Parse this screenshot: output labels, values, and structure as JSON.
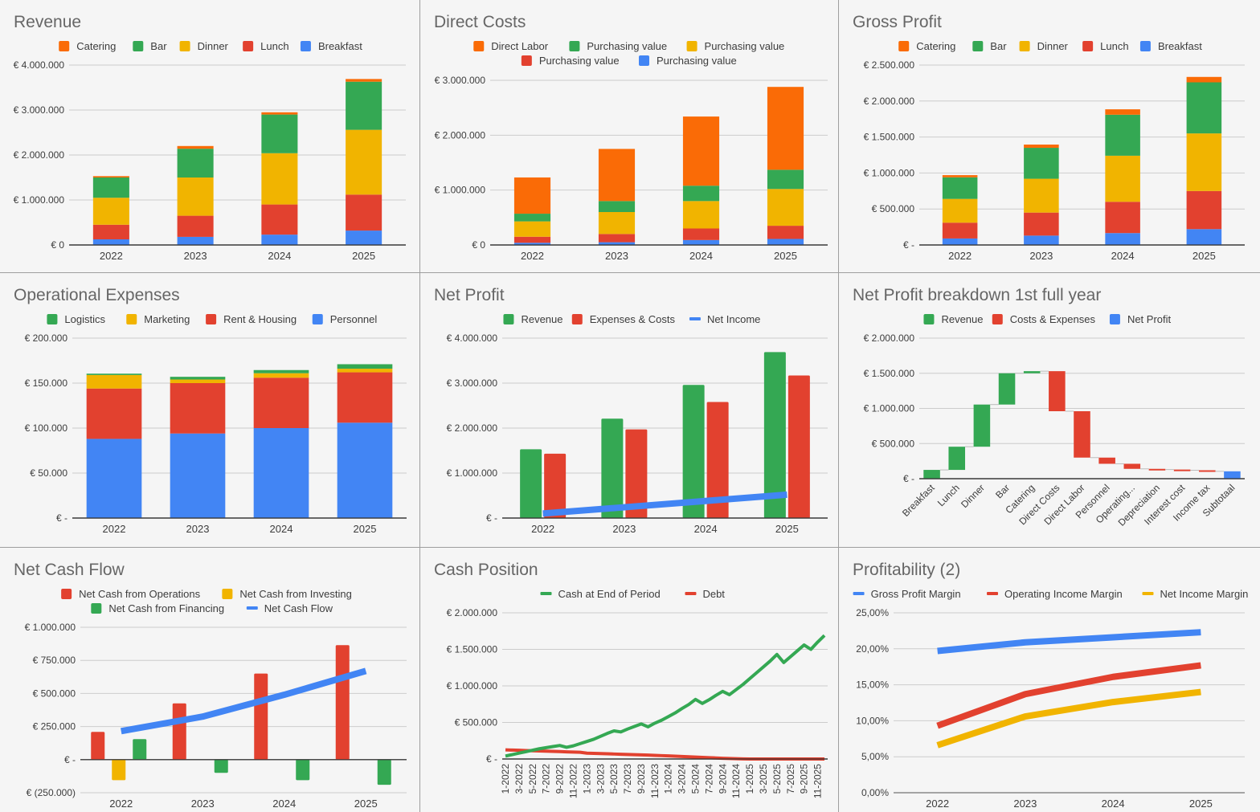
{
  "colors": {
    "blue": "#4285f4",
    "red": "#e2412f",
    "yellow": "#f1b400",
    "green": "#34a853",
    "orange": "#fa6b06",
    "title": "#666666",
    "text": "#3c3c3c",
    "grid": "#cccccc",
    "axis": "#333333"
  },
  "chart_data": [
    {
      "id": "revenue",
      "type": "bar",
      "stacked": true,
      "title": "Revenue",
      "legend": [
        "Catering",
        "Bar",
        "Dinner",
        "Lunch",
        "Breakfast"
      ],
      "legend_colors": [
        "orange",
        "green",
        "yellow",
        "red",
        "blue"
      ],
      "legend_position": "top",
      "categories": [
        "2022",
        "2023",
        "2024",
        "2025"
      ],
      "series": [
        {
          "name": "Breakfast",
          "color": "blue",
          "values": [
            125000,
            180000,
            230000,
            320000
          ]
        },
        {
          "name": "Lunch",
          "color": "red",
          "values": [
            325000,
            470000,
            670000,
            800000
          ]
        },
        {
          "name": "Dinner",
          "color": "yellow",
          "values": [
            600000,
            850000,
            1140000,
            1440000
          ]
        },
        {
          "name": "Bar",
          "color": "green",
          "values": [
            450000,
            640000,
            860000,
            1070000
          ]
        },
        {
          "name": "Catering",
          "color": "orange",
          "values": [
            30000,
            60000,
            50000,
            60000
          ]
        }
      ],
      "ylim": [
        0,
        4000000
      ],
      "yticks": [
        0,
        1000000,
        2000000,
        3000000,
        4000000
      ],
      "ytick_labels": [
        "€ 0",
        "€ 1.000.000",
        "€ 2.000.000",
        "€ 3.000.000",
        "€ 4.000.000"
      ],
      "grid": true
    },
    {
      "id": "direct-costs",
      "type": "bar",
      "stacked": true,
      "title": "Direct Costs",
      "legend": [
        "Direct Labor",
        "Purchasing value",
        "Purchasing value",
        "Purchasing value",
        "Purchasing value"
      ],
      "legend_colors": [
        "orange",
        "green",
        "yellow",
        "red",
        "blue"
      ],
      "legend_rows": [
        3,
        2
      ],
      "legend_position": "top",
      "categories": [
        "2022",
        "2023",
        "2024",
        "2025"
      ],
      "series": [
        {
          "name": "Purchasing value",
          "color": "blue",
          "values": [
            40000,
            50000,
            90000,
            110000
          ]
        },
        {
          "name": "Purchasing value",
          "color": "red",
          "values": [
            110000,
            150000,
            210000,
            240000
          ]
        },
        {
          "name": "Purchasing value",
          "color": "yellow",
          "values": [
            280000,
            400000,
            500000,
            670000
          ]
        },
        {
          "name": "Purchasing value",
          "color": "green",
          "values": [
            140000,
            200000,
            280000,
            350000
          ]
        },
        {
          "name": "Direct Labor",
          "color": "orange",
          "values": [
            660000,
            950000,
            1260000,
            1510000
          ]
        }
      ],
      "ylim": [
        0,
        3000000
      ],
      "yticks": [
        0,
        1000000,
        2000000,
        3000000
      ],
      "ytick_labels": [
        "€ 0",
        "€ 1.000.000",
        "€ 2.000.000",
        "€ 3.000.000"
      ],
      "grid": true
    },
    {
      "id": "gross-profit",
      "type": "bar",
      "stacked": true,
      "title": "Gross Profit",
      "legend": [
        "Catering",
        "Bar",
        "Dinner",
        "Lunch",
        "Breakfast"
      ],
      "legend_colors": [
        "orange",
        "green",
        "yellow",
        "red",
        "blue"
      ],
      "legend_position": "top",
      "categories": [
        "2022",
        "2023",
        "2024",
        "2025"
      ],
      "series": [
        {
          "name": "Breakfast",
          "color": "blue",
          "values": [
            90000,
            130000,
            165000,
            220000
          ]
        },
        {
          "name": "Lunch",
          "color": "red",
          "values": [
            220000,
            320000,
            435000,
            530000
          ]
        },
        {
          "name": "Dinner",
          "color": "yellow",
          "values": [
            330000,
            470000,
            640000,
            800000
          ]
        },
        {
          "name": "Bar",
          "color": "green",
          "values": [
            300000,
            430000,
            570000,
            710000
          ]
        },
        {
          "name": "Catering",
          "color": "orange",
          "values": [
            30000,
            45000,
            75000,
            75000
          ]
        }
      ],
      "ylim": [
        0,
        2500000
      ],
      "yticks": [
        0,
        500000,
        1000000,
        1500000,
        2000000,
        2500000
      ],
      "ytick_labels": [
        "€ -",
        "€ 500.000",
        "€ 1.000.000",
        "€ 1.500.000",
        "€ 2.000.000",
        "€ 2.500.000"
      ],
      "grid": true
    },
    {
      "id": "operational-expenses",
      "type": "bar",
      "stacked": true,
      "title": "Operational Expenses",
      "legend": [
        "Logistics",
        "Marketing",
        "Rent & Housing",
        "Personnel"
      ],
      "legend_colors": [
        "green",
        "yellow",
        "red",
        "blue"
      ],
      "legend_position": "top",
      "categories": [
        "2022",
        "2023",
        "2024",
        "2025"
      ],
      "series": [
        {
          "name": "Personnel",
          "color": "blue",
          "values": [
            88000,
            94000,
            100000,
            106000
          ]
        },
        {
          "name": "Rent & Housing",
          "color": "red",
          "values": [
            56000,
            56000,
            56000,
            56000
          ]
        },
        {
          "name": "Marketing",
          "color": "yellow",
          "values": [
            15000,
            4000,
            5000,
            4000
          ]
        },
        {
          "name": "Logistics",
          "color": "green",
          "values": [
            1500,
            3000,
            3500,
            5000
          ]
        }
      ],
      "ylim": [
        0,
        200000
      ],
      "yticks": [
        0,
        50000,
        100000,
        150000,
        200000
      ],
      "ytick_labels": [
        "€ -",
        "€ 50.000",
        "€ 100.000",
        "€ 150.000",
        "€ 200.000"
      ],
      "grid": true
    },
    {
      "id": "net-profit",
      "type": "bar",
      "stacked": false,
      "title": "Net Profit",
      "legend": [
        "Revenue",
        "Expenses & Costs",
        "Net Income"
      ],
      "legend_colors": [
        "green",
        "red",
        "blue"
      ],
      "legend_kinds": [
        "box",
        "box",
        "line"
      ],
      "legend_position": "top",
      "categories": [
        "2022",
        "2023",
        "2024",
        "2025"
      ],
      "series": [
        {
          "name": "Revenue",
          "color": "green",
          "kind": "bar",
          "values": [
            1530000,
            2210000,
            2960000,
            3690000
          ]
        },
        {
          "name": "Expenses & Costs",
          "color": "red",
          "kind": "bar",
          "values": [
            1430000,
            1970000,
            2580000,
            3170000
          ]
        },
        {
          "name": "Net Income",
          "color": "blue",
          "kind": "line",
          "values": [
            100000,
            240000,
            380000,
            520000
          ]
        }
      ],
      "ylim": [
        0,
        4000000
      ],
      "yticks": [
        0,
        1000000,
        2000000,
        3000000,
        4000000
      ],
      "ytick_labels": [
        "€ -",
        "€ 1.000.000",
        "€ 2.000.000",
        "€ 3.000.000",
        "€ 4.000.000"
      ],
      "grid": true
    },
    {
      "id": "net-profit-breakdown",
      "type": "bar",
      "subtype": "waterfall",
      "title": "Net Profit breakdown 1st full year",
      "legend": [
        "Revenue",
        "Costs & Expenses",
        "Net Profit"
      ],
      "legend_colors": [
        "green",
        "red",
        "blue"
      ],
      "legend_position": "top",
      "categories": [
        "Breakfast",
        "Lunch",
        "Dinner",
        "Bar",
        "Catering",
        "Direct Costs",
        "Direct Labor",
        "Personnel",
        "Operating...",
        "Depreciation",
        "Interest cost",
        "Income tax",
        "Subtotaal"
      ],
      "steps": [
        {
          "label": "Breakfast",
          "type": "increase",
          "value": 125000
        },
        {
          "label": "Lunch",
          "type": "increase",
          "value": 330000
        },
        {
          "label": "Dinner",
          "type": "increase",
          "value": 600000
        },
        {
          "label": "Bar",
          "type": "increase",
          "value": 445000
        },
        {
          "label": "Catering",
          "type": "increase",
          "value": 30000
        },
        {
          "label": "Direct Costs",
          "type": "decrease",
          "value": -570000
        },
        {
          "label": "Direct Labor",
          "type": "decrease",
          "value": -660000
        },
        {
          "label": "Personnel",
          "type": "decrease",
          "value": -88000
        },
        {
          "label": "Operating...",
          "type": "decrease",
          "value": -72000
        },
        {
          "label": "Depreciation",
          "type": "decrease",
          "value": -10000
        },
        {
          "label": "Interest cost",
          "type": "decrease",
          "value": -10000
        },
        {
          "label": "Income tax",
          "type": "decrease",
          "value": -15000
        },
        {
          "label": "Subtotaal",
          "type": "total",
          "value": 105000
        }
      ],
      "ylim": [
        0,
        2000000
      ],
      "yticks": [
        0,
        500000,
        1000000,
        1500000,
        2000000
      ],
      "ytick_labels": [
        "€ -",
        "€ 500.000",
        "€ 1.000.000",
        "€ 1.500.000",
        "€ 2.000.000"
      ],
      "grid": true
    },
    {
      "id": "net-cash-flow",
      "type": "bar",
      "stacked": false,
      "title": "Net Cash Flow",
      "legend": [
        "Net Cash from Operations",
        "Net Cash from Investing",
        "Net Cash from Financing",
        "Net Cash Flow"
      ],
      "legend_colors": [
        "red",
        "yellow",
        "green",
        "blue"
      ],
      "legend_kinds": [
        "box",
        "box",
        "box",
        "line"
      ],
      "legend_rows": [
        2,
        2
      ],
      "legend_position": "top",
      "categories": [
        "2022",
        "2023",
        "2024",
        "2025"
      ],
      "series": [
        {
          "name": "Net Cash from Operations",
          "color": "red",
          "kind": "bar",
          "values": [
            210000,
            425000,
            650000,
            865000
          ]
        },
        {
          "name": "Net Cash from Investing",
          "color": "yellow",
          "kind": "bar",
          "values": [
            -155000,
            0,
            0,
            0
          ]
        },
        {
          "name": "Net Cash from Financing",
          "color": "green",
          "kind": "bar",
          "values": [
            155000,
            -100000,
            -155000,
            -190000
          ]
        },
        {
          "name": "Net Cash Flow",
          "color": "blue",
          "kind": "line",
          "values": [
            215000,
            325000,
            490000,
            670000
          ]
        }
      ],
      "ylim": [
        -250000,
        1000000
      ],
      "yticks": [
        -250000,
        0,
        250000,
        500000,
        750000,
        1000000
      ],
      "ytick_labels": [
        "€ (250.000)",
        "€ -",
        "€ 250.000",
        "€ 500.000",
        "€ 750.000",
        "€ 1.000.000"
      ],
      "grid": true
    },
    {
      "id": "cash-position",
      "type": "line",
      "title": "Cash Position",
      "legend": [
        "Cash at End of Period",
        "Debt"
      ],
      "legend_colors": [
        "green",
        "red"
      ],
      "legend_position": "top",
      "x": [
        "1-2022",
        "2-2022",
        "3-2022",
        "4-2022",
        "5-2022",
        "6-2022",
        "7-2022",
        "8-2022",
        "9-2022",
        "10-2022",
        "11-2022",
        "12-2022",
        "1-2023",
        "2-2023",
        "3-2023",
        "4-2023",
        "5-2023",
        "6-2023",
        "7-2023",
        "8-2023",
        "9-2023",
        "10-2023",
        "11-2023",
        "12-2023",
        "1-2024",
        "2-2024",
        "3-2024",
        "4-2024",
        "5-2024",
        "6-2024",
        "7-2024",
        "8-2024",
        "9-2024",
        "10-2024",
        "11-2024",
        "12-2024",
        "1-2025",
        "2-2025",
        "3-2025",
        "4-2025",
        "5-2025",
        "6-2025",
        "7-2025",
        "8-2025",
        "9-2025",
        "10-2025",
        "11-2025",
        "12-2025"
      ],
      "xtick_labels": [
        "1-2022",
        "3-2022",
        "5-2022",
        "7-2022",
        "9-2022",
        "11-2022",
        "1-2023",
        "3-2023",
        "5-2023",
        "7-2023",
        "9-2023",
        "11-2023",
        "1-2024",
        "3-2024",
        "5-2024",
        "7-2024",
        "9-2024",
        "11-2024",
        "1-2025",
        "3-2025",
        "5-2025",
        "7-2025",
        "9-2025",
        "11-2025"
      ],
      "series": [
        {
          "name": "Cash at End of Period",
          "color": "green",
          "values": [
            40000,
            60000,
            80000,
            100000,
            120000,
            140000,
            155000,
            170000,
            185000,
            160000,
            180000,
            210000,
            240000,
            270000,
            310000,
            350000,
            385000,
            370000,
            410000,
            445000,
            480000,
            440000,
            490000,
            530000,
            580000,
            630000,
            690000,
            745000,
            815000,
            760000,
            810000,
            870000,
            925000,
            880000,
            950000,
            1020000,
            1100000,
            1180000,
            1260000,
            1340000,
            1430000,
            1320000,
            1400000,
            1480000,
            1560000,
            1500000,
            1600000,
            1690000
          ]
        },
        {
          "name": "Debt",
          "color": "red",
          "values": [
            125000,
            122000,
            119000,
            116000,
            113000,
            110000,
            107000,
            104000,
            101000,
            98000,
            95000,
            92000,
            80000,
            77000,
            74000,
            71000,
            68000,
            65000,
            62000,
            59000,
            56000,
            53000,
            50000,
            46000,
            42000,
            38000,
            34000,
            30000,
            26000,
            22000,
            18000,
            14000,
            10000,
            7000,
            4000,
            2000,
            0,
            0,
            0,
            0,
            0,
            0,
            0,
            0,
            0,
            0,
            0,
            0
          ]
        }
      ],
      "ylim": [
        0,
        2000000
      ],
      "yticks": [
        0,
        500000,
        1000000,
        1500000,
        2000000
      ],
      "ytick_labels": [
        "€ -",
        "€ 500.000",
        "€ 1.000.000",
        "€ 1.500.000",
        "€ 2.000.000"
      ],
      "grid": true
    },
    {
      "id": "profitability",
      "type": "line",
      "title": "Profitability (2)",
      "legend": [
        "Gross Profit Margin",
        "Operating Income Margin",
        "Net Income Margin"
      ],
      "legend_colors": [
        "blue",
        "red",
        "yellow"
      ],
      "legend_position": "top",
      "categories": [
        "2022",
        "2023",
        "2024",
        "2025"
      ],
      "series": [
        {
          "name": "Gross Profit Margin",
          "color": "blue",
          "values": [
            19.7,
            20.9,
            21.6,
            22.3
          ]
        },
        {
          "name": "Operating Income Margin",
          "color": "red",
          "values": [
            9.3,
            13.7,
            16.1,
            17.7
          ]
        },
        {
          "name": "Net Income Margin",
          "color": "yellow",
          "values": [
            6.6,
            10.6,
            12.6,
            14.0
          ]
        }
      ],
      "ylim": [
        0,
        25
      ],
      "yticks": [
        0,
        5,
        10,
        15,
        20,
        25
      ],
      "ytick_labels": [
        "0,00%",
        "5,00%",
        "10,00%",
        "15,00%",
        "20,00%",
        "25,00%"
      ],
      "grid": true
    }
  ]
}
